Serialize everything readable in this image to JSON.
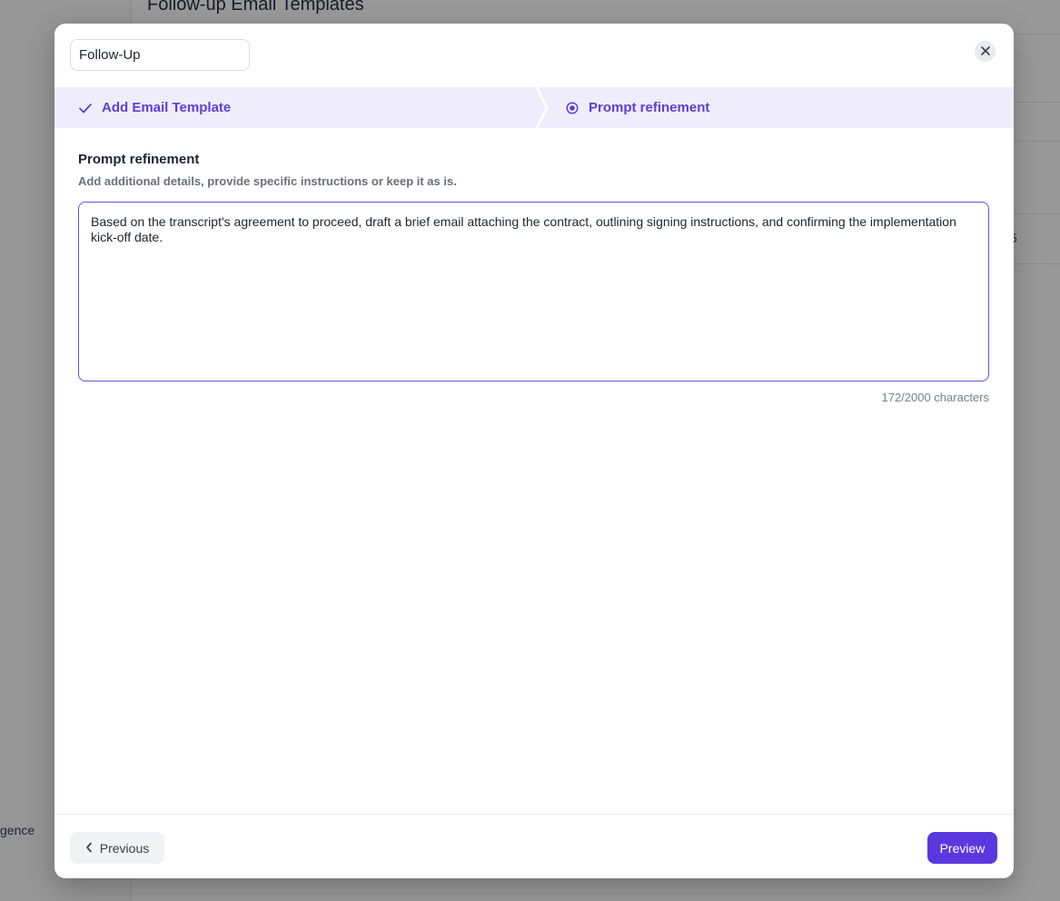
{
  "background": {
    "page_title": "Follow-up Email Templates",
    "sidebar_item_partial": "gence",
    "table_cell_partial": "5"
  },
  "modal": {
    "template_name_value": "Follow-Up",
    "close_icon": "close-icon",
    "steps": [
      {
        "label": "Add Email Template",
        "state": "completed",
        "icon": "check-icon"
      },
      {
        "label": "Prompt refinement",
        "state": "active",
        "icon": "radio-dot-icon"
      }
    ],
    "section": {
      "title": "Prompt refinement",
      "description": "Add additional details, provide specific instructions or keep it as is."
    },
    "prompt_value": "Based on the transcript's agreement to proceed, draft a brief email attaching the contract, outlining signing instructions, and confirming the implementation kick-off date.",
    "char_count": "172/2000 characters",
    "footer": {
      "previous_label": "Previous",
      "preview_label": "Preview"
    }
  },
  "colors": {
    "accent": "#5a38e0",
    "stepper_bg": "#efedfb",
    "overlay": "rgba(0,0,0,0.40)"
  }
}
